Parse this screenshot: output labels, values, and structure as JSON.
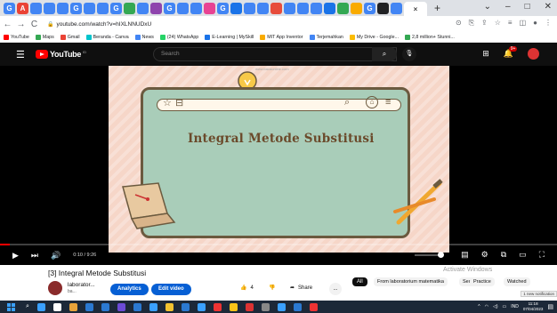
{
  "browser": {
    "tab_letters": [
      "G",
      "A",
      "",
      "",
      "",
      "G",
      "",
      "",
      "G",
      "",
      "",
      "",
      "G",
      "",
      "",
      "",
      "G",
      "",
      "",
      "",
      "",
      "",
      "",
      "",
      "",
      "",
      "",
      "G",
      "",
      ""
    ],
    "active_tab_close": "×",
    "new_tab": "+",
    "window_controls": [
      "⌄",
      "–",
      "□",
      "✕"
    ],
    "url": "youtube.com/watch?v=hIXLNNUDxU",
    "bookmarks": [
      {
        "label": "YouTube",
        "color": "#ff0000"
      },
      {
        "label": "Maps",
        "color": "#34a853"
      },
      {
        "label": "Gmail",
        "color": "#ea4335"
      },
      {
        "label": "Beranda - Canva",
        "color": "#00c4cc"
      },
      {
        "label": "News",
        "color": "#4285f4"
      },
      {
        "label": "(24) WhatsApp",
        "color": "#25d366"
      },
      {
        "label": "E-Learning | MySkill",
        "color": "#1a73e8"
      },
      {
        "label": "MIT App Inventor",
        "color": "#f9ab00"
      },
      {
        "label": "Terjemahkan",
        "color": "#4285f4"
      },
      {
        "label": "My Drive - Google...",
        "color": "#fbbc04"
      },
      {
        "label": "2,8 million+ Stunni...",
        "color": "#34a853"
      }
    ]
  },
  "youtube": {
    "logo_text": "YouTube",
    "logo_region": "ID",
    "search_placeholder": "Search",
    "notif_count": "9+"
  },
  "video": {
    "slide_title": "Integral Metode Substitusi",
    "watermark": "www.bacaonline.com",
    "time": "0:10 / 9:26",
    "progress": 0.018
  },
  "details": {
    "title": "[3] Integral Metode Substitusi",
    "channel": "laborator...",
    "subs": "ba...",
    "analytics": "Analytics",
    "edit": "Edit video",
    "likes": "4",
    "share": "Share",
    "more": "...",
    "chips": [
      "All",
      "From laboratorium matematika",
      "Sedang...",
      "Practice",
      "Watched"
    ],
    "activate_title": "Activate Windows",
    "activate_sub": "Go to Settings to activate Windows.",
    "new_notification": "1 new notification"
  },
  "taskbar": {
    "time": "11:18",
    "date": "07/04/2023",
    "lang": "IND",
    "icons": [
      "#3aa0ff",
      "#ffffff",
      "#e8a33a",
      "#2b79d1",
      "#2b79d1",
      "#6c4bd6",
      "#2b79d1",
      "#3aa0ff",
      "#f2c230",
      "#2b79d1",
      "#3aa0ff",
      "#e33",
      "#f8c318",
      "#d33",
      "#888",
      "#3aa0ff",
      "#2b79d1",
      "#e33"
    ]
  }
}
